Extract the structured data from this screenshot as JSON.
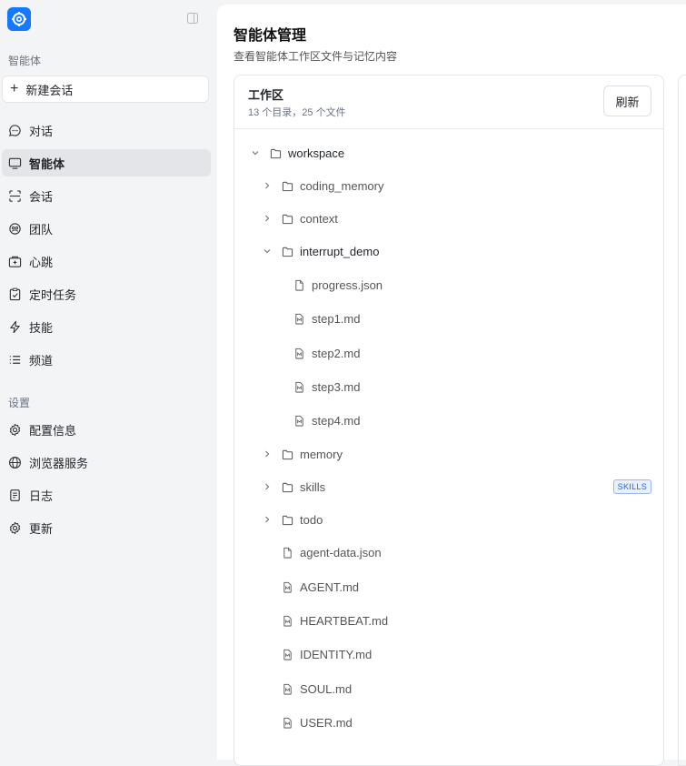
{
  "sidebar": {
    "section_agent": "智能体",
    "new_chat": "新建会话",
    "nav": [
      {
        "label": "对话",
        "icon": "chat-bubble-icon",
        "active": false
      },
      {
        "label": "智能体",
        "icon": "monitor-icon",
        "active": true
      },
      {
        "label": "会话",
        "icon": "scan-frame-icon",
        "active": false
      },
      {
        "label": "团队",
        "icon": "team-icon",
        "active": false
      },
      {
        "label": "心跳",
        "icon": "heartbeat-icon",
        "active": false
      },
      {
        "label": "定时任务",
        "icon": "clipboard-check-icon",
        "active": false
      },
      {
        "label": "技能",
        "icon": "lightning-icon",
        "active": false
      },
      {
        "label": "频道",
        "icon": "list-icon",
        "active": false
      }
    ],
    "section_settings": "设置",
    "settings": [
      {
        "label": "配置信息",
        "icon": "gear-icon"
      },
      {
        "label": "浏览器服务",
        "icon": "globe-icon"
      },
      {
        "label": "日志",
        "icon": "document-icon"
      },
      {
        "label": "更新",
        "icon": "gear-icon"
      }
    ]
  },
  "main": {
    "title": "智能体管理",
    "subtitle": "查看智能体工作区文件与记忆内容",
    "workspace_panel": {
      "title": "工作区",
      "count": "13 个目录，25 个文件",
      "refresh": "刷新"
    },
    "tree": [
      {
        "name": "workspace",
        "type": "folder",
        "depth": 0,
        "expanded": true
      },
      {
        "name": "coding_memory",
        "type": "folder",
        "depth": 1,
        "expanded": false
      },
      {
        "name": "context",
        "type": "folder",
        "depth": 1,
        "expanded": false
      },
      {
        "name": "interrupt_demo",
        "type": "folder",
        "depth": 1,
        "expanded": true
      },
      {
        "name": "progress.json",
        "type": "file",
        "depth": 2
      },
      {
        "name": "step1.md",
        "type": "md",
        "depth": 2
      },
      {
        "name": "step2.md",
        "type": "md",
        "depth": 2
      },
      {
        "name": "step3.md",
        "type": "md",
        "depth": 2
      },
      {
        "name": "step4.md",
        "type": "md",
        "depth": 2
      },
      {
        "name": "memory",
        "type": "folder",
        "depth": 1,
        "expanded": false
      },
      {
        "name": "skills",
        "type": "folder",
        "depth": 1,
        "expanded": false,
        "badge": "SKILLS"
      },
      {
        "name": "todo",
        "type": "folder",
        "depth": 1,
        "expanded": false
      },
      {
        "name": "agent-data.json",
        "type": "file",
        "depth": 1
      },
      {
        "name": "AGENT.md",
        "type": "md",
        "depth": 1
      },
      {
        "name": "HEARTBEAT.md",
        "type": "md",
        "depth": 1
      },
      {
        "name": "IDENTITY.md",
        "type": "md",
        "depth": 1
      },
      {
        "name": "SOUL.md",
        "type": "md",
        "depth": 1
      },
      {
        "name": "USER.md",
        "type": "md",
        "depth": 1
      }
    ]
  },
  "colors": {
    "accent": "#1677ff",
    "badge": "#2563eb",
    "active_bg": "#e3e5e8"
  }
}
